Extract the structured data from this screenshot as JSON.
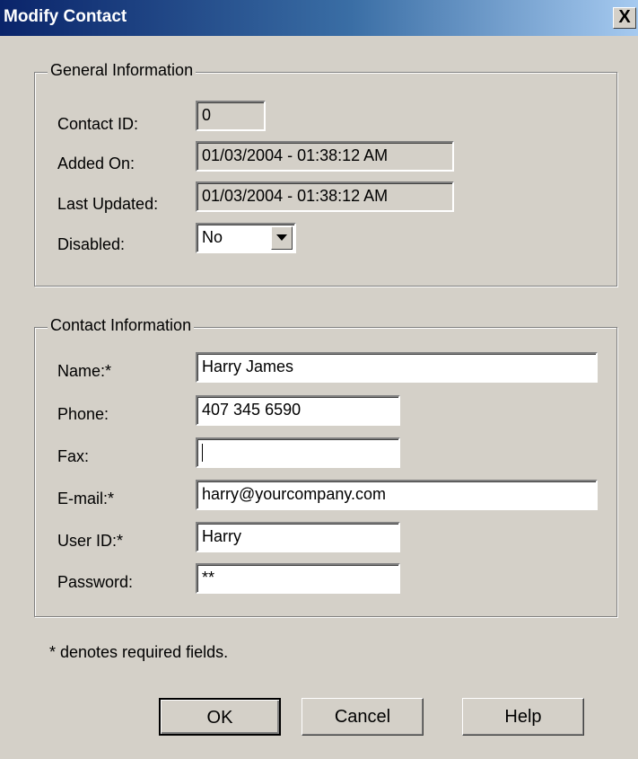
{
  "window": {
    "title": "Modify Contact",
    "close_glyph": "X"
  },
  "general": {
    "legend": "General Information",
    "contact_id_label": "Contact ID:",
    "contact_id": "0",
    "added_on_label": "Added On:",
    "added_on": "01/03/2004 - 01:38:12 AM",
    "last_updated_label": "Last Updated:",
    "last_updated": "01/03/2004 - 01:38:12 AM",
    "disabled_label": "Disabled:",
    "disabled_value": "No"
  },
  "contact": {
    "legend": "Contact Information",
    "name_label": "Name:*",
    "name": "Harry James",
    "phone_label": "Phone:",
    "phone": "407 345 6590",
    "fax_label": "Fax:",
    "fax": "",
    "email_label": "E-mail:*",
    "email": "harry@yourcompany.com",
    "userid_label": "User ID:*",
    "userid": "Harry",
    "password_label": "Password:",
    "password": "**"
  },
  "note": "* denotes required fields.",
  "buttons": {
    "ok": "OK",
    "cancel": "Cancel",
    "help": "Help"
  },
  "icons": {
    "close": "close-icon",
    "dropdown": "chevron-down-icon"
  }
}
